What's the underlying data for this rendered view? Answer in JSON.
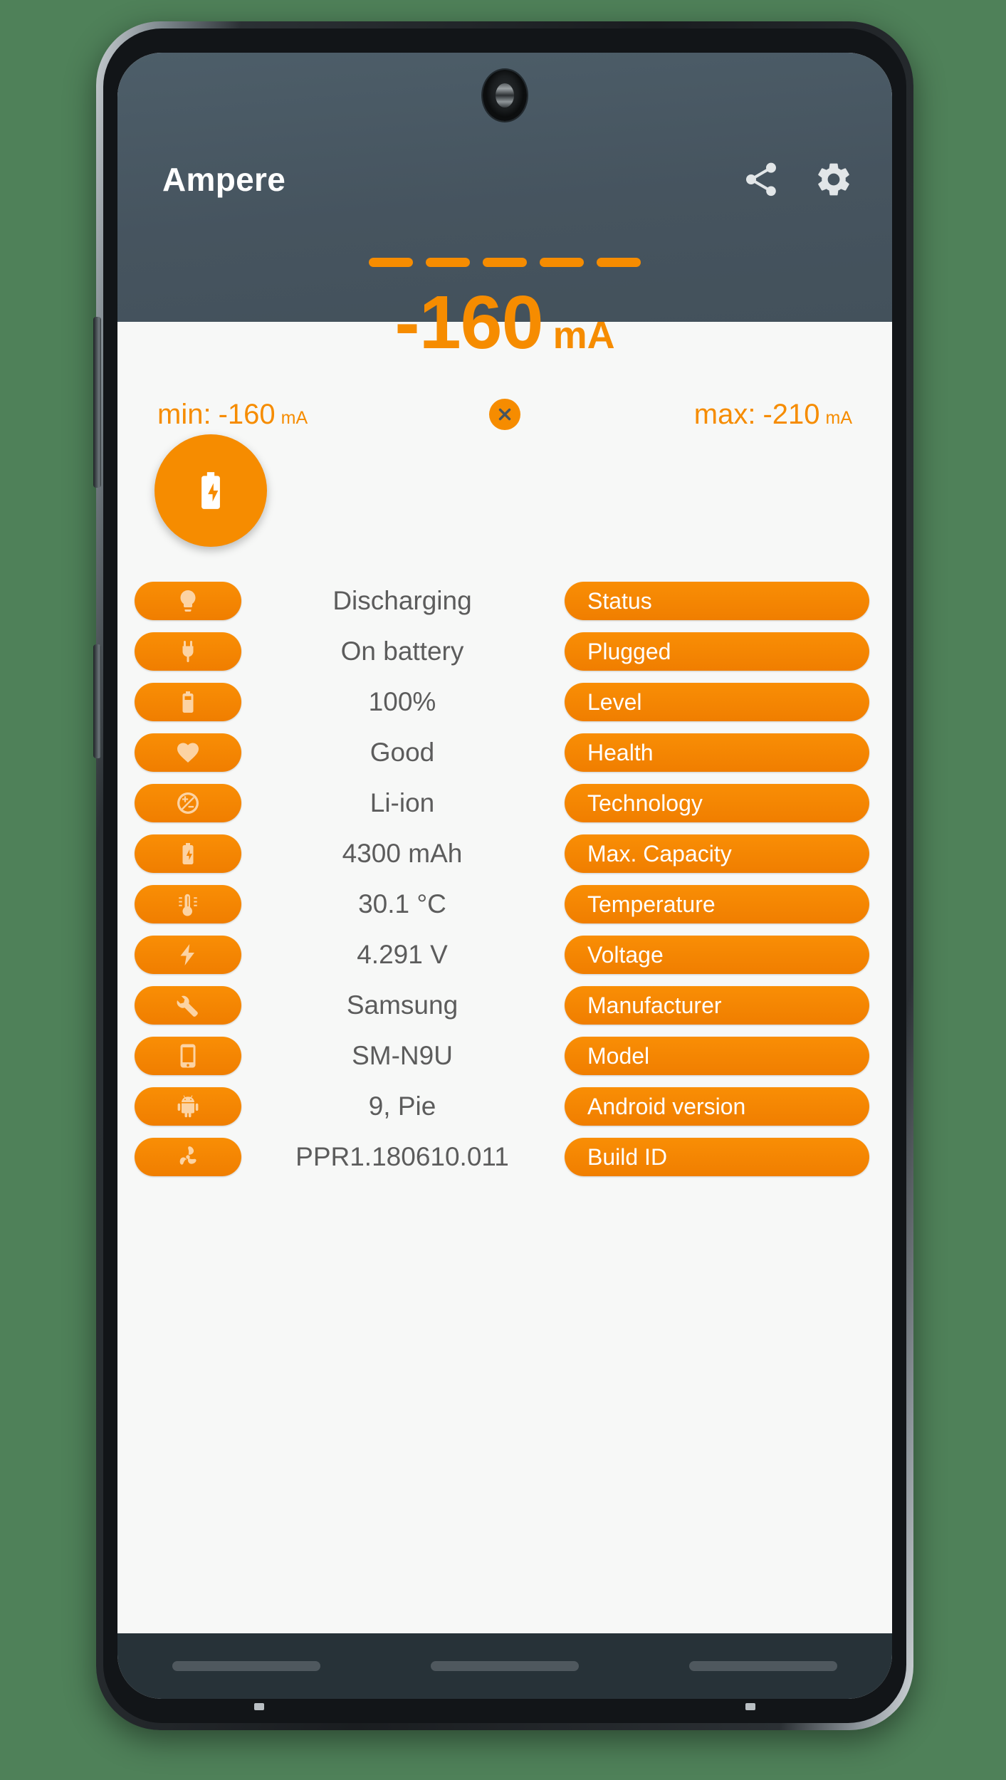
{
  "app": {
    "title": "Ampere"
  },
  "header": {
    "share_icon": "share-icon",
    "settings_icon": "gear-icon",
    "dash_count": 5,
    "reading": {
      "value": "-160",
      "unit": "mA"
    },
    "min": {
      "label": "min:",
      "value": "-160",
      "unit": "mA"
    },
    "max": {
      "label": "max:",
      "value": "-210",
      "unit": "mA"
    },
    "reset_icon": "close-circle-icon"
  },
  "fab": {
    "icon": "battery-charging-icon"
  },
  "rows": [
    {
      "icon": "lightbulb-icon",
      "value": "Discharging",
      "label": "Status"
    },
    {
      "icon": "power-plug-icon",
      "value": "On battery",
      "label": "Plugged"
    },
    {
      "icon": "battery-icon",
      "value": "100%",
      "label": "Level"
    },
    {
      "icon": "heart-icon",
      "value": "Good",
      "label": "Health"
    },
    {
      "icon": "plus-minus-circle-icon",
      "value": "Li-ion",
      "label": "Technology"
    },
    {
      "icon": "battery-bolt-icon",
      "value": "4300 mAh",
      "label": "Max. Capacity"
    },
    {
      "icon": "thermometer-icon",
      "value": "30.1 °C",
      "label": "Temperature"
    },
    {
      "icon": "lightning-bolt-icon",
      "value": "4.291 V",
      "label": "Voltage"
    },
    {
      "icon": "wrench-icon",
      "value": "Samsung",
      "label": "Manufacturer"
    },
    {
      "icon": "smartphone-icon",
      "value": "SM-N9U",
      "label": "Model"
    },
    {
      "icon": "android-icon",
      "value": "9, Pie",
      "label": "Android version"
    },
    {
      "icon": "fan-icon",
      "value": "PPR1.180610.011",
      "label": "Build ID"
    }
  ],
  "nav_bar": {
    "back": "nav-back-pill",
    "home": "nav-home-pill",
    "recent": "nav-recent-pill"
  },
  "colors": {
    "accent_orange": "#F68C00",
    "header_slate": "#46545f",
    "value_gray": "#5c5c5c",
    "screen_bg": "#f7f8f7",
    "nav_bar_bg": "#273238",
    "backdrop_green": "#4f8159"
  }
}
